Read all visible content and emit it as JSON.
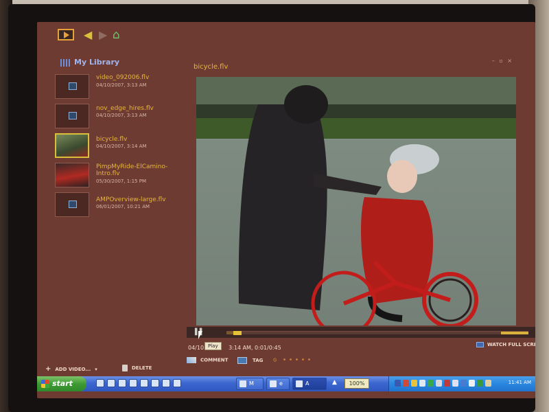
{
  "app": {
    "nav_back_glyph": "◀",
    "nav_fwd_glyph": "▶",
    "nav_home_glyph": "⌂",
    "window_controls": "– ▫ ×"
  },
  "library": {
    "title": "My Library",
    "items": [
      {
        "name": "video_092006.flv",
        "date": "04/10/2007, 3:13 AM",
        "thumb": "placeholder"
      },
      {
        "name": "nov_edge_hires.flv",
        "date": "04/10/2007, 3:13 AM",
        "thumb": "placeholder"
      },
      {
        "name": "bicycle.flv",
        "date": "04/10/2007, 3:14 AM",
        "thumb": "selected"
      },
      {
        "name": "PimpMyRide-ElCamino-Intro.flv",
        "date": "05/30/2007, 1:15 PM",
        "thumb": "image"
      },
      {
        "name": "AMPOverview-large.flv",
        "date": "06/01/2007, 10:21 AM",
        "thumb": "placeholder"
      }
    ],
    "add_video_label": "ADD VIDEO...",
    "delete_label": "DELETE"
  },
  "player": {
    "title": "bicycle.flv",
    "tooltip": "Play",
    "info_prefix": "04/10",
    "info_suffix": "3:14 AM, 0:01/0:45",
    "progress_fraction": 0.022,
    "watch_full_screen_label": "WATCH FULL SCREEN",
    "comment_label": "COMMENT",
    "tag_label": "TAG",
    "rating_stars": 0,
    "rating_max": 5
  },
  "taskbar": {
    "start_label": "start",
    "zoom": "100%",
    "task_items": [
      {
        "label": "M",
        "active": false
      },
      {
        "label": "e",
        "active": false
      },
      {
        "label": "A",
        "active": true
      }
    ],
    "clock": "11:41 AM"
  },
  "colors": {
    "accent": "#e6b63c",
    "library_title": "#9fb5ef",
    "background": "#6e3b32"
  }
}
